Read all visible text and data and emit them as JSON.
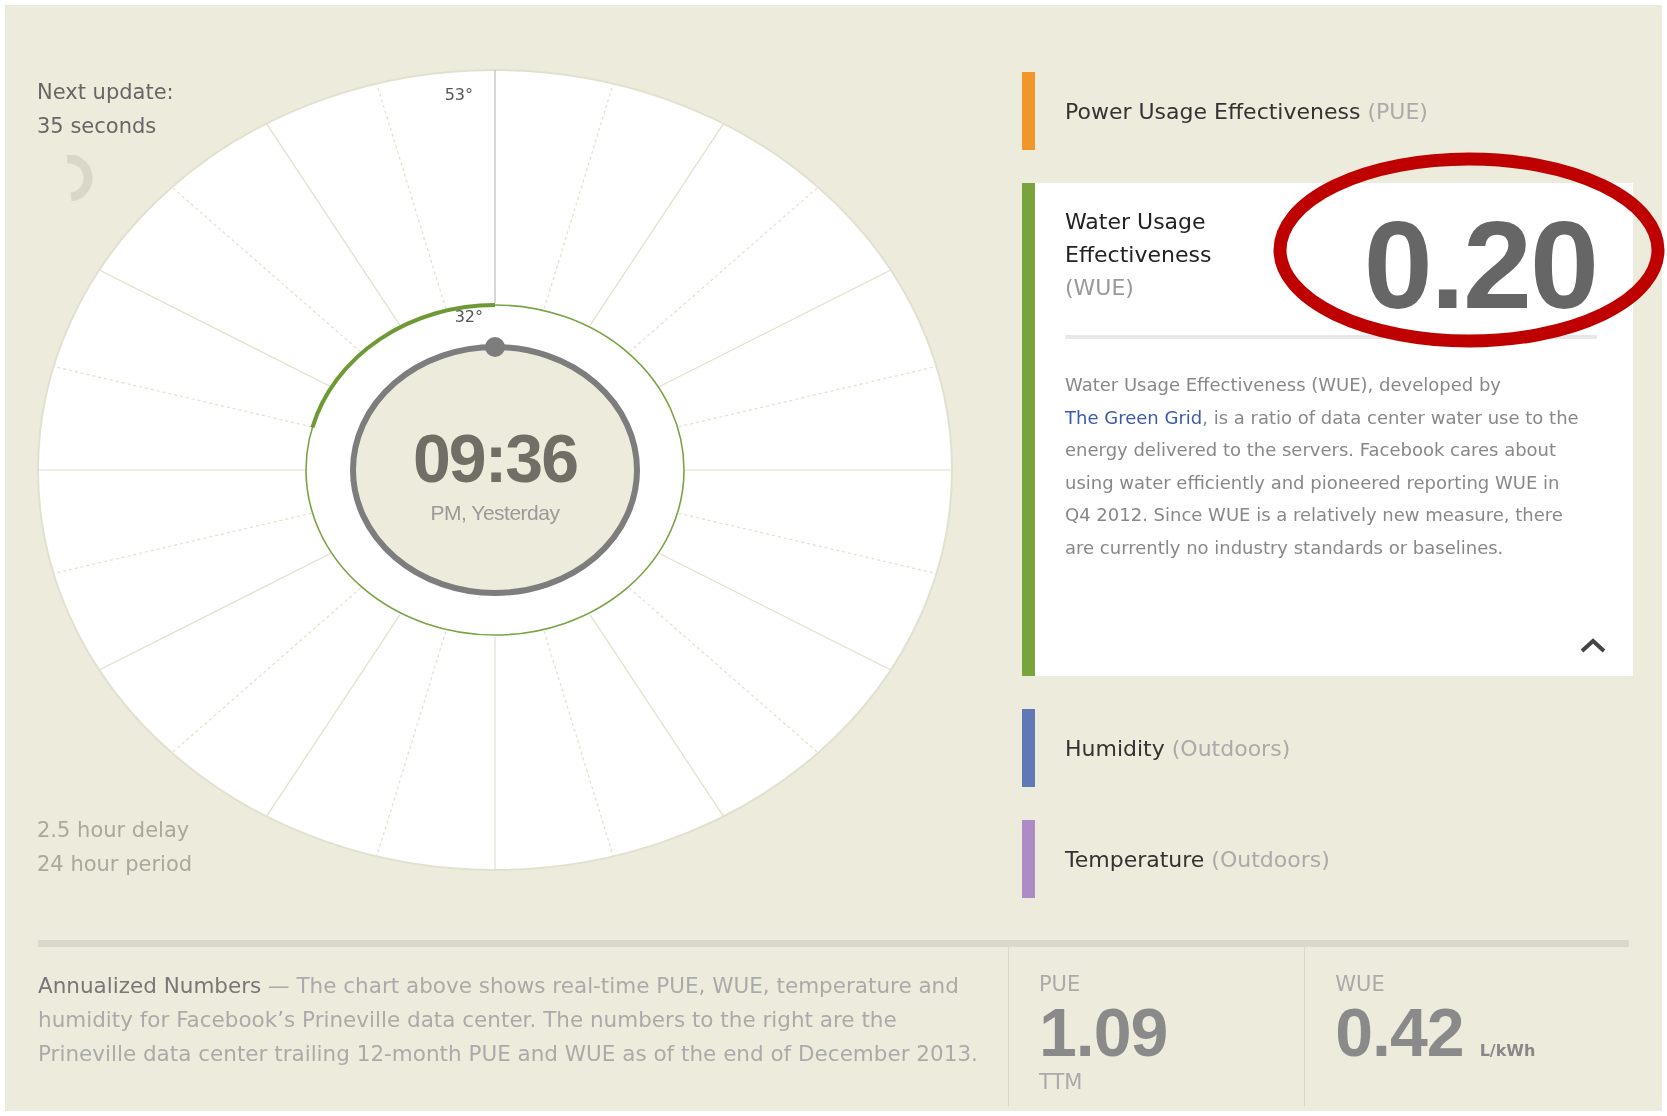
{
  "update": {
    "label": "Next update:",
    "value": "35 seconds"
  },
  "dial": {
    "max_label": "53°",
    "min_label": "32°",
    "time": "09:36",
    "period": "PM, Yesterday"
  },
  "notes": [
    "2.5 hour delay",
    "24 hour period"
  ],
  "metrics": [
    {
      "title": "Power Usage Effectiveness",
      "qualifier": "(PUE)",
      "color": "#f0962a",
      "expanded": false
    },
    {
      "title": "Water Usage Effectiveness",
      "qualifier": "(WUE)",
      "color": "#79a33d",
      "expanded": true,
      "highlighted": true,
      "value": "0.20",
      "description_before": "Water Usage Effectiveness (WUE), developed by ",
      "link": "The Green Grid",
      "description_after": ", is a ratio of data center water use to the energy delivered to the servers. Facebook cares about using water efficiently and pioneered reporting WUE in Q4 2012. Since WUE is a relatively new measure, there are currently no industry standards or baselines."
    },
    {
      "title": "Humidity",
      "qualifier": "(Outdoors)",
      "color": "#6079b5",
      "expanded": false
    },
    {
      "title": "Temperature",
      "qualifier": "(Outdoors)",
      "color": "#ad8bc4",
      "expanded": false
    }
  ],
  "annualized": {
    "lead": "Annualized Numbers",
    "text": " — The chart above shows real-time PUE, WUE, temperature and humidity for Facebook’s Prineville data center. The numbers to the right are the Prineville data center trailing 12-month PUE and WUE as of the end of December 2013.",
    "stats": [
      {
        "label": "PUE",
        "value": "1.09",
        "footnote": "TTM"
      },
      {
        "label": "WUE",
        "value": "0.42",
        "unit": "L/kWh"
      }
    ]
  }
}
